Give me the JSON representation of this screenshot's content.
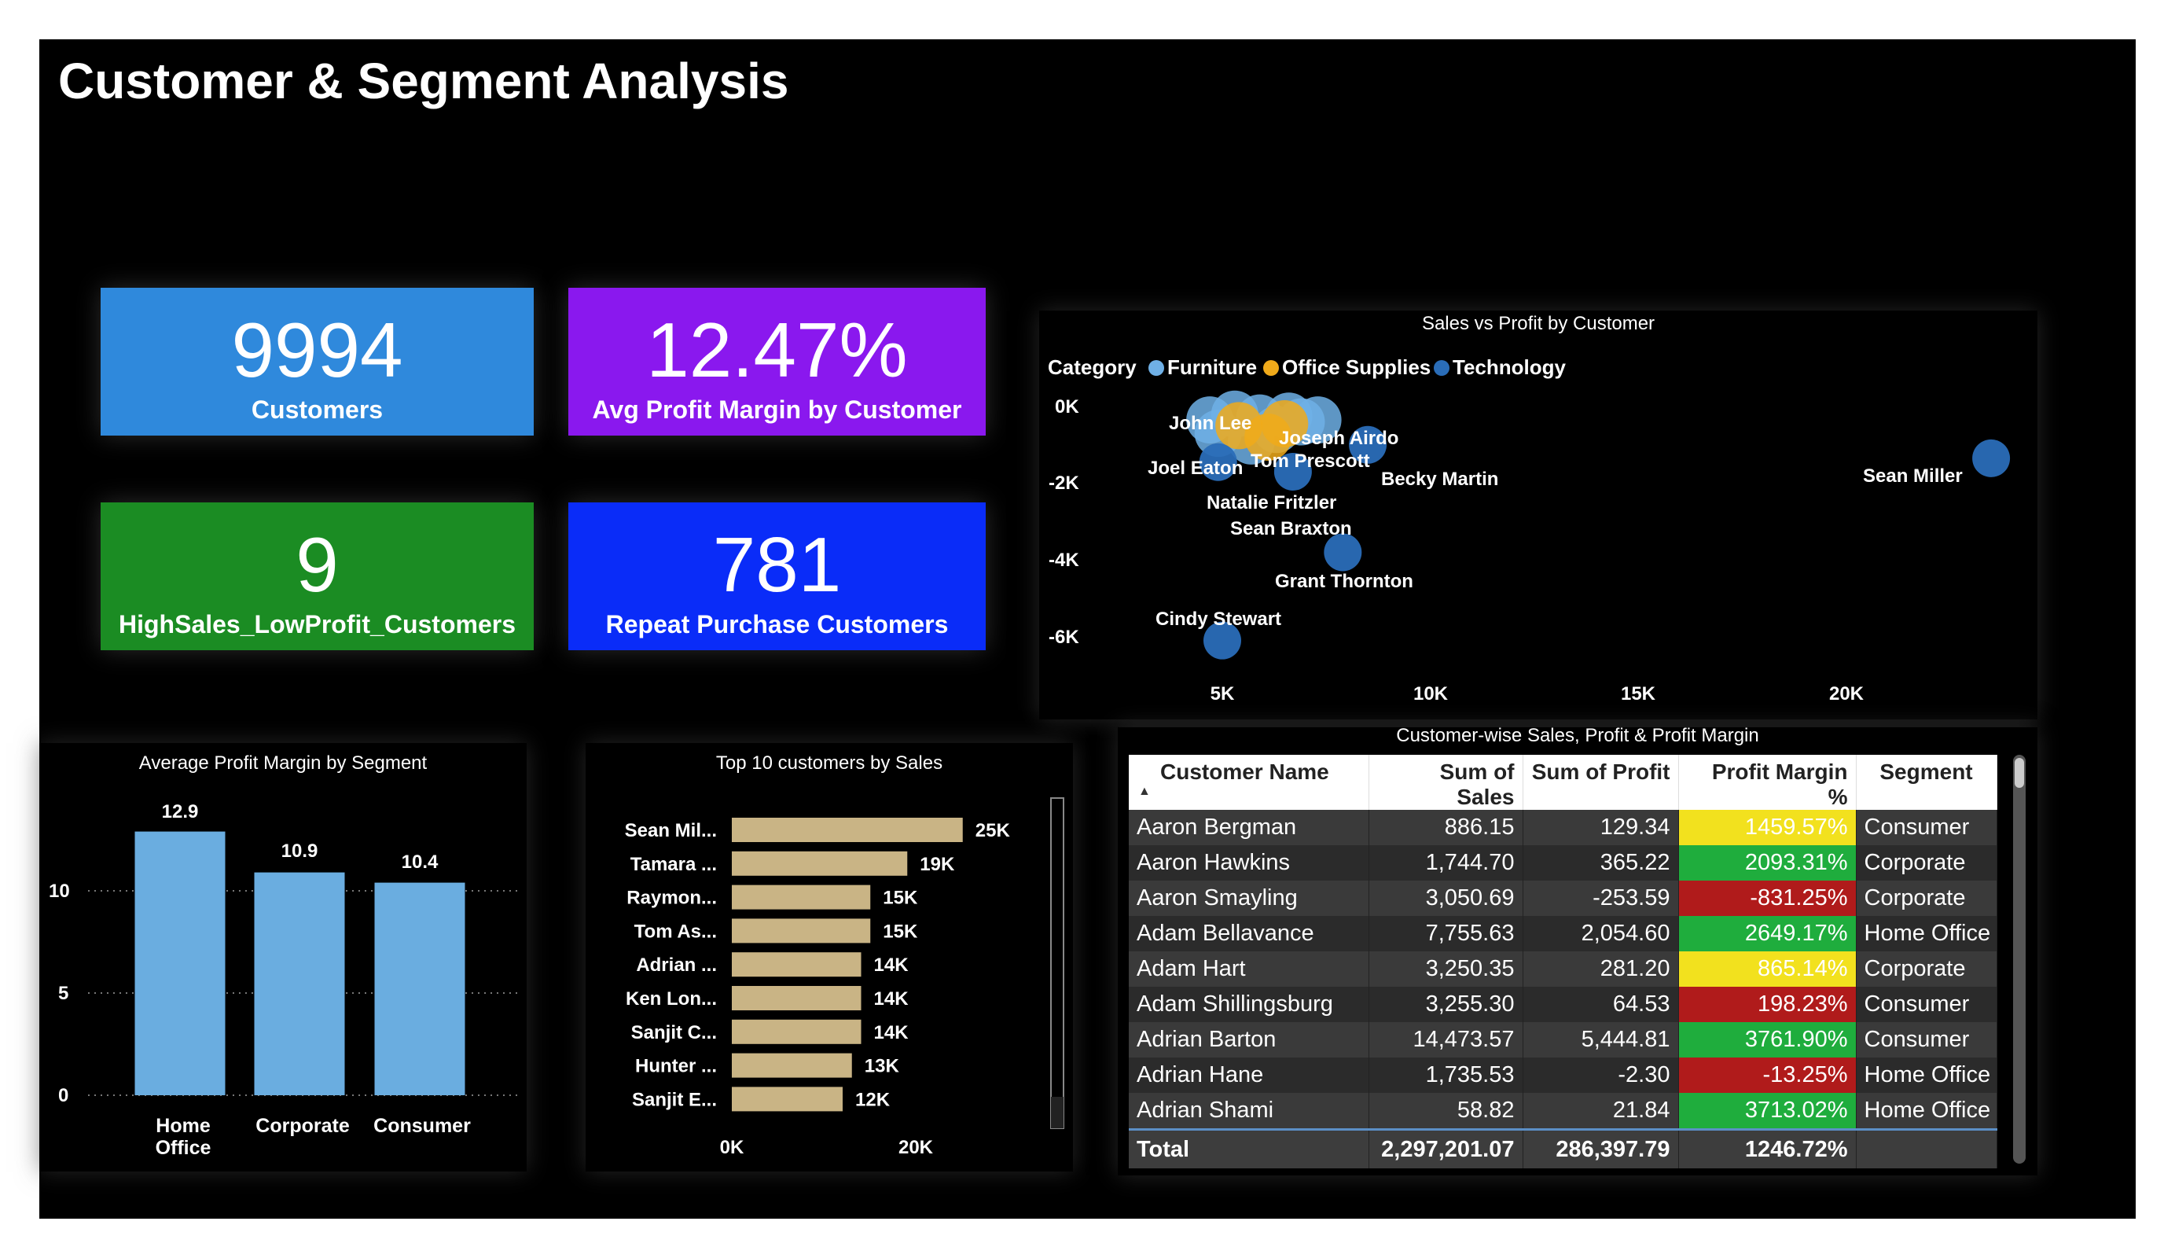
{
  "title": "Customer & Segment Analysis",
  "kpis": [
    {
      "value": "9994",
      "label": "Customers",
      "color": "#2f89dc"
    },
    {
      "value": "12.47%",
      "label": "Avg Profit Margin by Customer",
      "color": "#8a18ee"
    },
    {
      "value": "9",
      "label": "HighSales_LowProfit_Customers",
      "color": "#1b8c23"
    },
    {
      "value": "781",
      "label": "Repeat Purchase Customers",
      "color": "#0a2cf8"
    }
  ],
  "scatter": {
    "title": "Sales vs Profit by Customer",
    "legend_title": "Category",
    "legend": [
      {
        "name": "Furniture",
        "color": "#6fb0e6"
      },
      {
        "name": "Office Supplies",
        "color": "#f0aa1a"
      },
      {
        "name": "Technology",
        "color": "#2a6db8"
      }
    ],
    "x_ticks": [
      "5K",
      "10K",
      "15K",
      "20K"
    ],
    "y_ticks": [
      "0K",
      "-2K",
      "-4K",
      "-6K"
    ],
    "labels": [
      "John Lee",
      "Joseph Airdo",
      "Tom Prescott",
      "Joel Eaton",
      "Becky Martin",
      "Natalie Fritzler",
      "Sean Braxton",
      "Grant Thornton",
      "Cindy Stewart",
      "Sean Miller"
    ]
  },
  "seg_chart": {
    "title": "Average Profit Margin by Segment",
    "categories": [
      "Home\nOffice",
      "Corporate",
      "Consumer"
    ],
    "values": [
      "12.9",
      "10.9",
      "10.4"
    ],
    "y_ticks": [
      "0",
      "5",
      "10"
    ],
    "bar_color": "#6aade0"
  },
  "top_chart": {
    "title": "Top 10 customers by Sales",
    "names": [
      "Sean Mil...",
      "Tamara ...",
      "Raymon...",
      "Tom As...",
      "Adrian ...",
      "Ken Lon...",
      "Sanjit C...",
      "Hunter ...",
      "Sanjit E..."
    ],
    "labels": [
      "25K",
      "19K",
      "15K",
      "15K",
      "14K",
      "14K",
      "14K",
      "13K",
      "12K"
    ],
    "x_ticks": [
      "0K",
      "20K"
    ],
    "bar_color": "#c9b485"
  },
  "chart_data": [
    {
      "type": "bar",
      "title": "Average Profit Margin by Segment",
      "categories": [
        "Home Office",
        "Corporate",
        "Consumer"
      ],
      "values": [
        12.9,
        10.9,
        10.4
      ],
      "ylim": [
        0,
        14
      ]
    },
    {
      "type": "bar",
      "title": "Top 10 customers by Sales",
      "categories": [
        "Sean Mil...",
        "Tamara ...",
        "Raymon...",
        "Tom As...",
        "Adrian ...",
        "Ken Lon...",
        "Sanjit C...",
        "Hunter ...",
        "Sanjit E..."
      ],
      "values": [
        25000,
        19000,
        15000,
        15000,
        14000,
        14000,
        14000,
        13000,
        12000
      ],
      "xlim": [
        0,
        27000
      ]
    },
    {
      "type": "scatter",
      "title": "Sales vs Profit by Customer",
      "xlabel": "",
      "ylabel": "",
      "xlim": [
        3000,
        24000
      ],
      "ylim": [
        -6800,
        300
      ],
      "series": [
        {
          "name": "Furniture",
          "points": [
            {
              "x": 4700,
              "y": -350
            },
            {
              "x": 5300,
              "y": -200
            },
            {
              "x": 5900,
              "y": -300
            },
            {
              "x": 6600,
              "y": -250
            },
            {
              "x": 4900,
              "y": -700
            },
            {
              "x": 6300,
              "y": -600
            },
            {
              "x": 5700,
              "y": -900
            },
            {
              "x": 6900,
              "y": -400
            },
            {
              "x": 7300,
              "y": -350
            }
          ]
        },
        {
          "name": "Office Supplies",
          "points": [
            {
              "x": 5400,
              "y": -500
            },
            {
              "x": 6100,
              "y": -800
            },
            {
              "x": 6500,
              "y": -450
            }
          ]
        },
        {
          "name": "Technology",
          "points": [
            {
              "x": 8500,
              "y": -1000
            },
            {
              "x": 4900,
              "y": -1450
            },
            {
              "x": 6700,
              "y": -1700
            },
            {
              "x": 7900,
              "y": -3800
            },
            {
              "x": 5000,
              "y": -6100
            },
            {
              "x": 23500,
              "y": -1350
            }
          ]
        }
      ]
    }
  ],
  "table": {
    "title": "Customer-wise Sales, Profit & Profit Margin",
    "columns": [
      "Customer Name",
      "Sum of Sales",
      "Sum of Profit",
      "Profit Margin %",
      "Segment"
    ],
    "rows": [
      {
        "name": "Aaron Bergman",
        "sales": "886.15",
        "profit": "129.34",
        "margin": "1459.57%",
        "color": "yellow",
        "segment": "Consumer"
      },
      {
        "name": "Aaron Hawkins",
        "sales": "1,744.70",
        "profit": "365.22",
        "margin": "2093.31%",
        "color": "green",
        "segment": "Corporate"
      },
      {
        "name": "Aaron Smayling",
        "sales": "3,050.69",
        "profit": "-253.59",
        "margin": "-831.25%",
        "color": "red",
        "segment": "Corporate"
      },
      {
        "name": "Adam Bellavance",
        "sales": "7,755.63",
        "profit": "2,054.60",
        "margin": "2649.17%",
        "color": "green",
        "segment": "Home Office"
      },
      {
        "name": "Adam Hart",
        "sales": "3,250.35",
        "profit": "281.20",
        "margin": "865.14%",
        "color": "yellow",
        "segment": "Corporate"
      },
      {
        "name": "Adam Shillingsburg",
        "sales": "3,255.30",
        "profit": "64.53",
        "margin": "198.23%",
        "color": "red",
        "segment": "Consumer"
      },
      {
        "name": "Adrian Barton",
        "sales": "14,473.57",
        "profit": "5,444.81",
        "margin": "3761.90%",
        "color": "green",
        "segment": "Consumer"
      },
      {
        "name": "Adrian Hane",
        "sales": "1,735.53",
        "profit": "-2.30",
        "margin": "-13.25%",
        "color": "red",
        "segment": "Home Office"
      },
      {
        "name": "Adrian Shami",
        "sales": "58.82",
        "profit": "21.84",
        "margin": "3713.02%",
        "color": "green",
        "segment": "Home Office"
      }
    ],
    "total": {
      "label": "Total",
      "sales": "2,297,201.07",
      "profit": "286,397.79",
      "margin": "1246.72%"
    }
  }
}
